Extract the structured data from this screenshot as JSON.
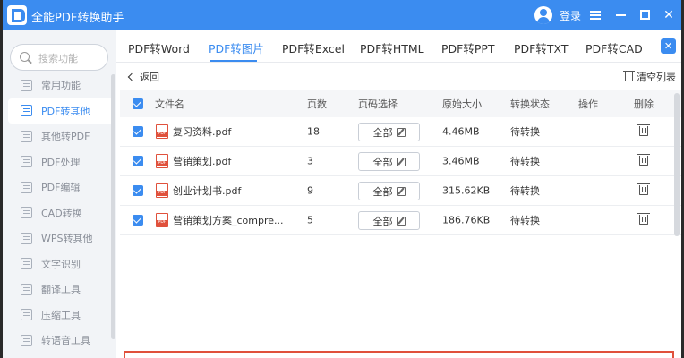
{
  "app": {
    "title": "全能PDF转换助手",
    "login_label": "登录"
  },
  "window_controls": {
    "menu": "menu-icon",
    "minimize": "minimize-icon",
    "maximize": "maximize-icon",
    "close": "close-icon"
  },
  "sidebar": {
    "search_placeholder": "搜索功能",
    "items": [
      {
        "label": "常用功能",
        "icon": "star-icon"
      },
      {
        "label": "PDF转其他",
        "icon": "pdf-convert-icon",
        "active": true
      },
      {
        "label": "其他转PDF",
        "icon": "to-pdf-icon"
      },
      {
        "label": "PDF处理",
        "icon": "pdf-process-icon"
      },
      {
        "label": "PDF编辑",
        "icon": "pdf-edit-icon"
      },
      {
        "label": "CAD转换",
        "icon": "cad-icon"
      },
      {
        "label": "WPS转其他",
        "icon": "wps-icon"
      },
      {
        "label": "文字识别",
        "icon": "ocr-icon"
      },
      {
        "label": "翻译工具",
        "icon": "translate-icon"
      },
      {
        "label": "压缩工具",
        "icon": "compress-icon"
      },
      {
        "label": "转语音工具",
        "icon": "speech-icon"
      }
    ]
  },
  "tabs": [
    {
      "label": "PDF转Word"
    },
    {
      "label": "PDF转图片",
      "active": true
    },
    {
      "label": "PDF转Excel"
    },
    {
      "label": "PDF转HTML"
    },
    {
      "label": "PDF转PPT"
    },
    {
      "label": "PDF转TXT"
    },
    {
      "label": "PDF转CAD"
    }
  ],
  "toolbar": {
    "back_label": "返回",
    "clear_label": "清空列表"
  },
  "table": {
    "headers": {
      "file": "文件名",
      "pages": "页数",
      "page_select": "页码选择",
      "size": "原始大小",
      "status": "转换状态",
      "operation": "操作",
      "delete": "删除"
    },
    "rows": [
      {
        "name": "复习资料.pdf",
        "pages": "18",
        "page_select": "全部",
        "size": "4.46MB",
        "status": "待转换"
      },
      {
        "name": "营销策划.pdf",
        "pages": "3",
        "page_select": "全部",
        "size": "3.46MB",
        "status": "待转换"
      },
      {
        "name": "创业计划书.pdf",
        "pages": "9",
        "page_select": "全部",
        "size": "315.62KB",
        "status": "待转换"
      },
      {
        "name": "营销策划方案_compre...",
        "pages": "5",
        "page_select": "全部",
        "size": "186.76KB",
        "status": "待转换"
      }
    ]
  },
  "colors": {
    "accent": "#3b8cf0",
    "pdf_red": "#e0513c"
  }
}
